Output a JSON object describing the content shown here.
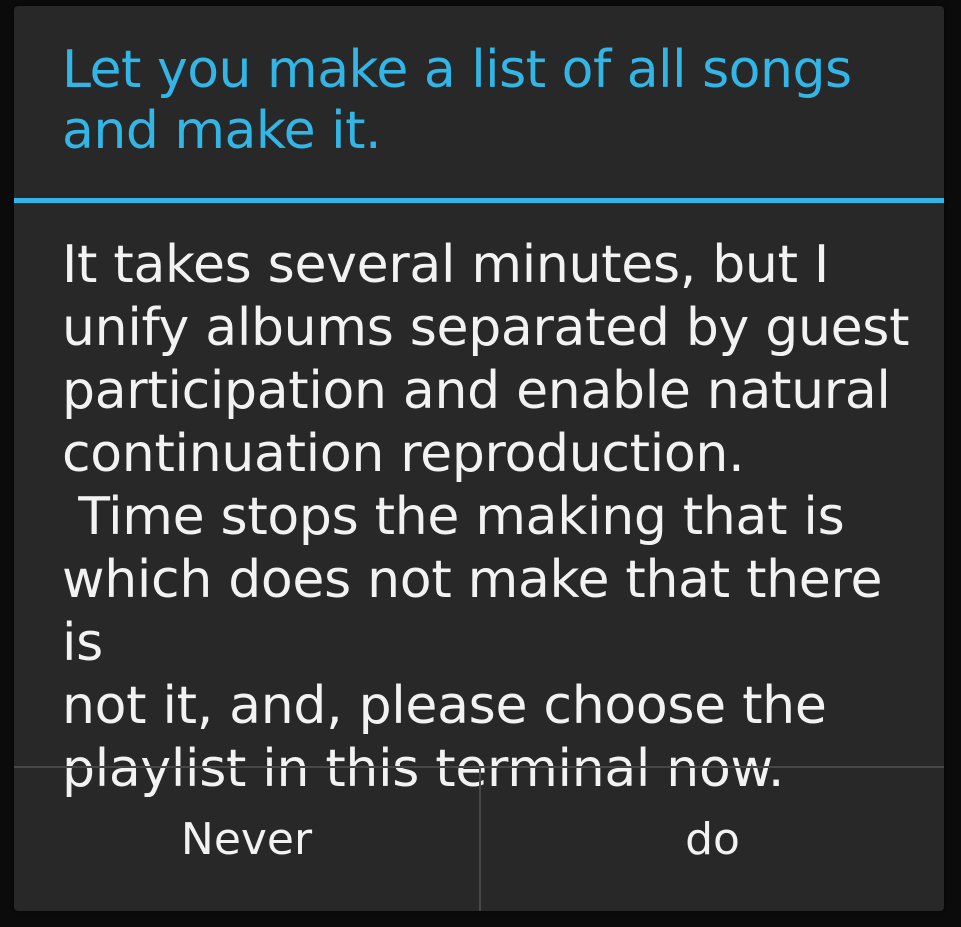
{
  "dialog": {
    "title": "Let you make a list of all songs\nand make it.",
    "message": "It takes several minutes, but I\nunify albums separated by guest\nparticipation and enable natural\ncontinuation reproduction.\n Time stops the making that is\nwhich does not make that there is\nnot it, and, please choose the\nplaylist in this terminal now.",
    "buttons": {
      "negative_label": "Never",
      "positive_label": "do"
    },
    "colors": {
      "accent": "#33b5e5",
      "background": "#282828",
      "text": "#f2f2f2",
      "divider": "#474747"
    }
  }
}
